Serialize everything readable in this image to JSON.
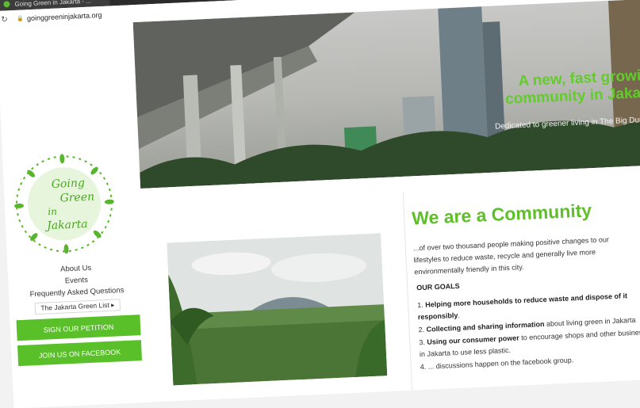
{
  "browser": {
    "tab_title": "Going Green in Jakarta - ...",
    "url": "goinggreeninjakarta.org"
  },
  "sidebar": {
    "logo_text": [
      "Going",
      "Green",
      "in",
      "Jakarta"
    ],
    "nav": [
      {
        "label": "About Us"
      },
      {
        "label": "Events"
      },
      {
        "label": "Frequently Asked Questions"
      }
    ],
    "sub_item": "The Jakarta Green List ▸",
    "buttons": {
      "petition": "SIGN OUR PETITION",
      "facebook": "JOIN US ON FACEBOOK"
    }
  },
  "hero": {
    "title_line1": "A new, fast growing",
    "title_line2": "community in Jakarta",
    "subtitle": "Dedicated to greener living in The Big Durian"
  },
  "content": {
    "heading": "We are a Community",
    "intro": "...of over two thousand people making positive changes to our lifestyles to reduce waste, recycle and generally live more environmentally friendly in this city.",
    "goals_heading": "OUR GOALS",
    "goals": [
      {
        "num": "1.",
        "bold": "Helping more households to reduce waste and dispose of it responsibly",
        "rest": "."
      },
      {
        "num": "2.",
        "bold": "Collecting and sharing information",
        "rest": " about living green in Jakarta"
      },
      {
        "num": "3.",
        "bold": "Using our consumer power",
        "rest": " to encourage shops and other businesses in Jakarta to use less plastic."
      },
      {
        "num": "4.",
        "bold": "",
        "rest": "... discussions happen on the facebook group."
      }
    ]
  },
  "colors": {
    "brand_green": "#5ac02a",
    "hero_title": "#62cc2b"
  }
}
